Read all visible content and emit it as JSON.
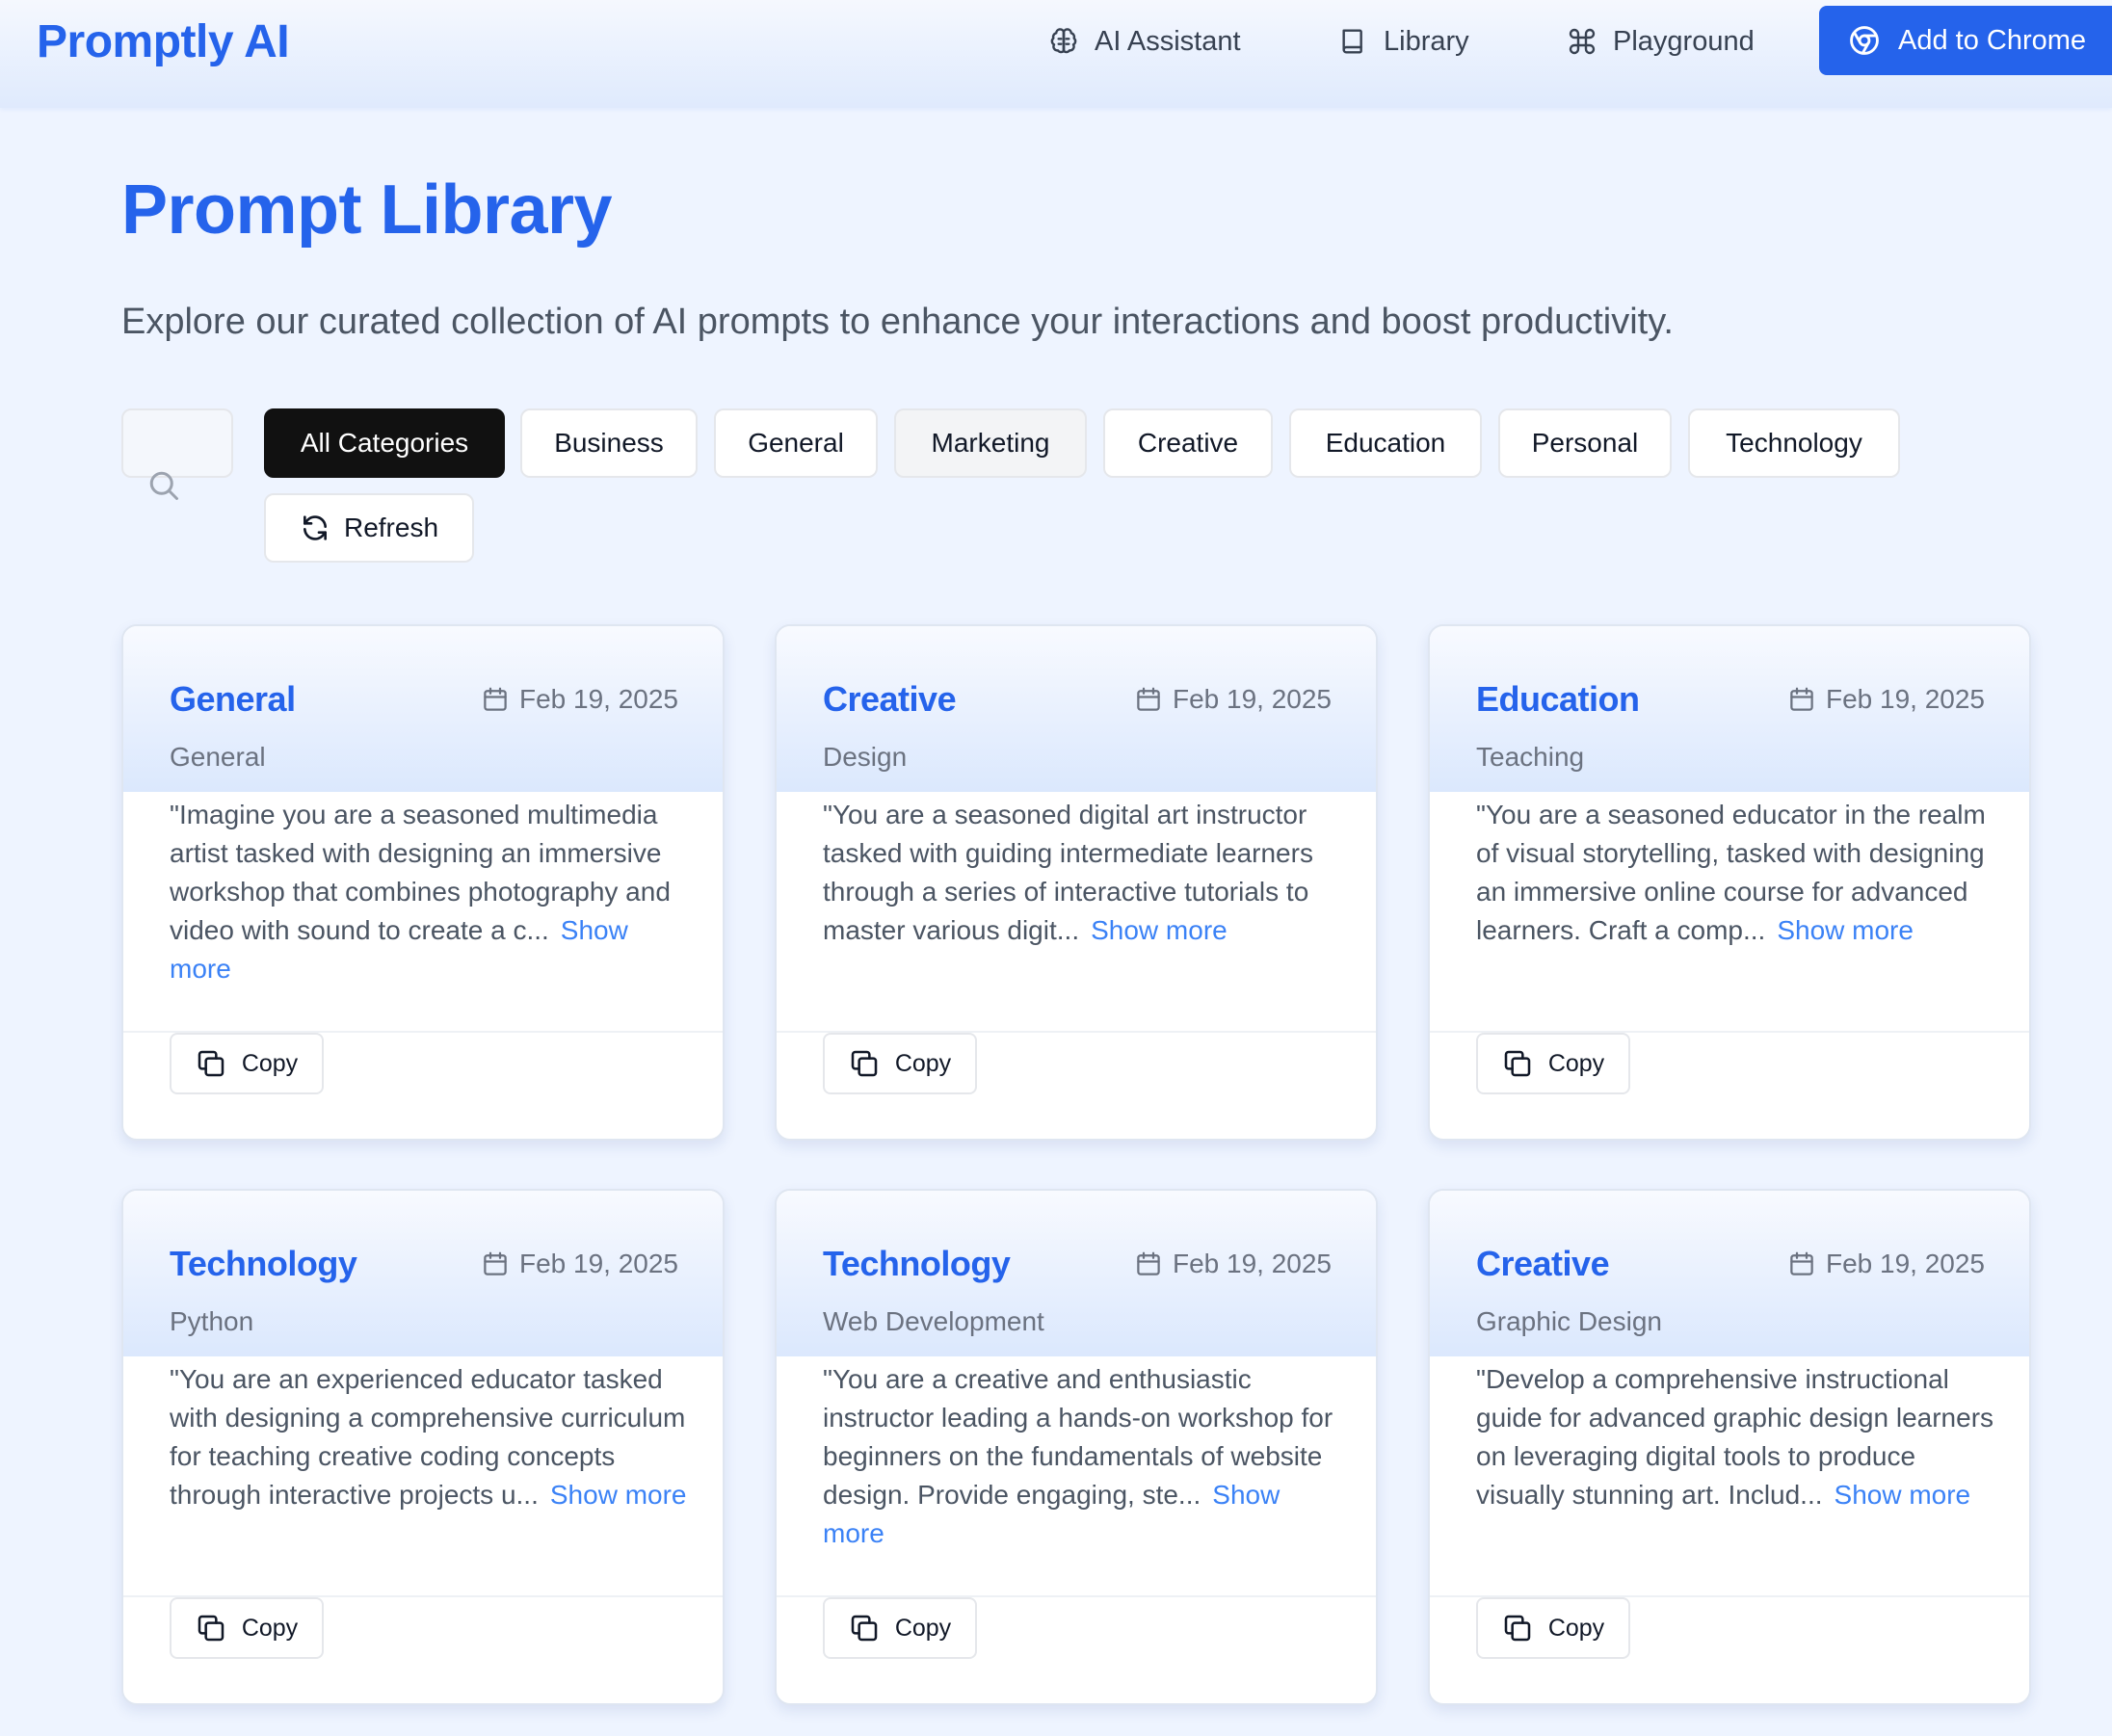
{
  "header": {
    "brand": "Promptly AI",
    "nav": [
      {
        "label": "AI Assistant",
        "icon": "brain-icon"
      },
      {
        "label": "Library",
        "icon": "book-icon"
      },
      {
        "label": "Playground",
        "icon": "command-icon"
      }
    ],
    "cta_label": "Add to Chrome",
    "cta_icon": "chrome-icon"
  },
  "hero": {
    "title": "Prompt Library",
    "subtitle": "Explore our curated collection of AI prompts to enhance your interactions and boost productivity."
  },
  "filters": {
    "search_value": "",
    "categories": [
      "All Categories",
      "Business",
      "General",
      "Marketing",
      "Creative",
      "Education",
      "Personal",
      "Technology"
    ],
    "active": "All Categories",
    "refresh_label": "Refresh"
  },
  "cards": [
    {
      "category": "General",
      "date": "Feb 19, 2025",
      "subcategory": "General",
      "excerpt": "\"Imagine you are a seasoned multimedia artist tasked with designing an immersive workshop that combines photography and video with sound to create a c...",
      "show_more": "Show more",
      "copy_label": "Copy"
    },
    {
      "category": "Creative",
      "date": "Feb 19, 2025",
      "subcategory": "Design",
      "excerpt": "\"You are a seasoned digital art instructor tasked with guiding intermediate learners through a series of interactive tutorials to master various digit...",
      "show_more": "Show more",
      "copy_label": "Copy"
    },
    {
      "category": "Education",
      "date": "Feb 19, 2025",
      "subcategory": "Teaching",
      "excerpt": "\"You are a seasoned educator in the realm of visual storytelling, tasked with designing an immersive online course for advanced learners. Craft a comp...",
      "show_more": "Show more",
      "copy_label": "Copy"
    },
    {
      "category": "Technology",
      "date": "Feb 19, 2025",
      "subcategory": "Python",
      "excerpt": "\"You are an experienced educator tasked with designing a comprehensive curriculum for teaching creative coding concepts through interactive projects u...",
      "show_more": "Show more",
      "copy_label": "Copy"
    },
    {
      "category": "Technology",
      "date": "Feb 19, 2025",
      "subcategory": "Web Development",
      "excerpt": "\"You are a creative and enthusiastic instructor leading a hands-on workshop for beginners on the fundamentals of website design. Provide engaging, ste...",
      "show_more": "Show more",
      "copy_label": "Copy"
    },
    {
      "category": "Creative",
      "date": "Feb 19, 2025",
      "subcategory": "Graphic Design",
      "excerpt": "\"Develop a comprehensive instructional guide for advanced graphic design learners on leveraging digital tools to produce visually stunning art. Includ...",
      "show_more": "Show more",
      "copy_label": "Copy"
    }
  ],
  "colors": {
    "accent": "#2563eb",
    "background": "#eef4ff",
    "active_chip": "#111111"
  }
}
